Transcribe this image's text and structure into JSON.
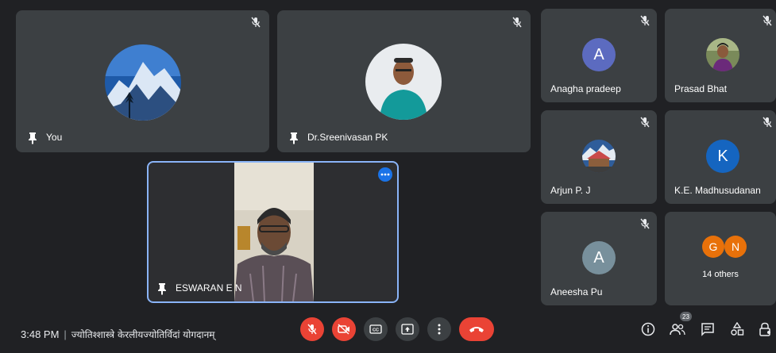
{
  "tiles": {
    "you": {
      "name": "You"
    },
    "sreenivasan": {
      "name": "Dr.Sreenivasan PK"
    },
    "eswaran": {
      "name": "ESWARAN E N"
    },
    "anagha": {
      "name": "Anagha pradeep",
      "initial": "A",
      "color": "#5c6bc0"
    },
    "prasad": {
      "name": "Prasad Bhat"
    },
    "arjun": {
      "name": "Arjun P. J"
    },
    "madhusudanan": {
      "name": "K.E. Madhusudanan",
      "initial": "K",
      "color": "#1565c0"
    },
    "aneesha": {
      "name": "Aneesha Pu",
      "initial": "A",
      "color": "#78909c"
    },
    "others": {
      "label": "14 others",
      "avatar1": "G",
      "avatar2": "N",
      "color": "#e8710a"
    }
  },
  "bottom_bar": {
    "time": "3:48 PM",
    "separator": "|",
    "meeting_title": "ज्योतिश्शास्त्रे केरलीयज्योतिर्विदां योगदानम्",
    "participant_count": "23"
  },
  "colors": {
    "background": "#202124",
    "tile": "#3c4043",
    "danger": "#ea4335",
    "active_border": "#8ab4f8"
  }
}
